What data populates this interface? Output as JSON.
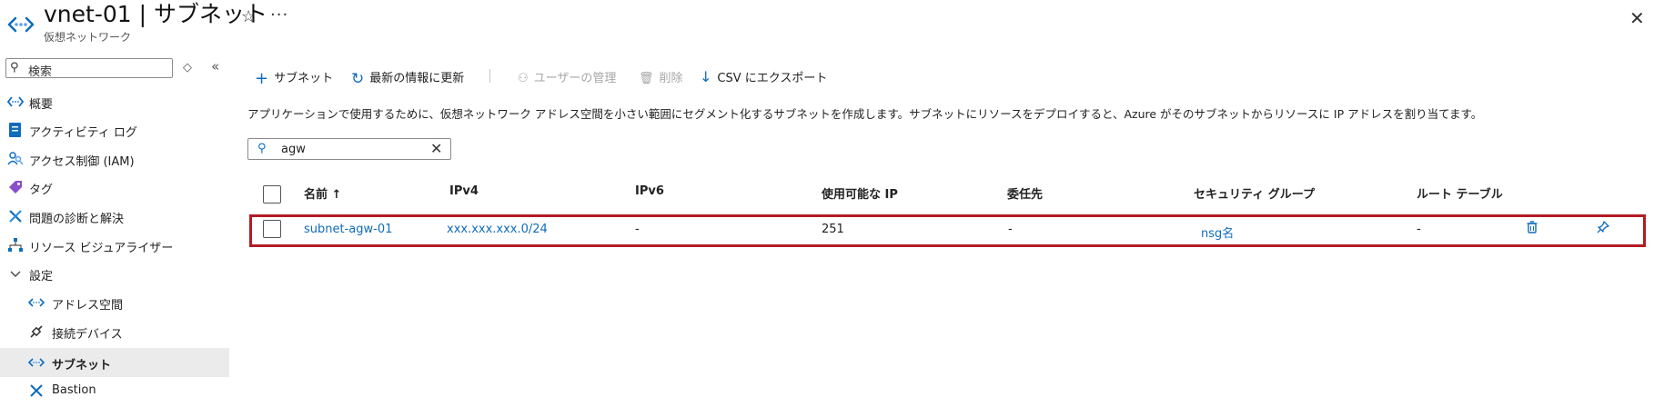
{
  "header": {
    "title": "vnet-01 | サブネット",
    "subtitle": "仮想ネットワーク",
    "star": "☆",
    "more": "···",
    "close": "✕"
  },
  "sidebar": {
    "search_placeholder": "検索",
    "collapse_glyph": "«",
    "sort_glyph": "◇",
    "items": [
      {
        "label": "概要",
        "icon": "vnet-icon"
      },
      {
        "label": "アクティビティ ログ",
        "icon": "activity-log-icon"
      },
      {
        "label": "アクセス制御 (IAM)",
        "icon": "iam-icon"
      },
      {
        "label": "タグ",
        "icon": "tag-icon"
      },
      {
        "label": "問題の診断と解決",
        "icon": "wrench-icon"
      },
      {
        "label": "リソース ビジュアライザー",
        "icon": "visualizer-icon"
      },
      {
        "label": "設定",
        "icon": "chevron-down-icon"
      },
      {
        "label": "アドレス空間",
        "icon": "address-space-icon"
      },
      {
        "label": "接続デバイス",
        "icon": "plug-icon"
      },
      {
        "label": "サブネット",
        "icon": "subnet-icon"
      },
      {
        "label": "Bastion",
        "icon": "bastion-icon"
      }
    ]
  },
  "toolbar": {
    "add_subnet": "サブネット",
    "refresh": "最新の情報に更新",
    "manage_users": "ユーザーの管理",
    "delete": "削除",
    "export_csv": "CSV にエクスポート"
  },
  "description": "アプリケーションで使用するために、仮想ネットワーク アドレス空間を小さい範囲にセグメント化するサブネットを作成します。サブネットにリソースをデプロイすると、Azure がそのサブネットからリソースに IP アドレスを割り当てます。",
  "filter": {
    "value": "agw"
  },
  "table": {
    "columns": [
      "名前 ↑",
      "IPv4",
      "IPv6",
      "使用可能な IP",
      "委任先",
      "セキュリティ グループ",
      "ルート テーブル"
    ],
    "rows": [
      {
        "name": "subnet-agw-01",
        "ipv4": "xxx.xxx.xxx.0/24",
        "ipv6": "-",
        "available_ips": "251",
        "delegated_to": "-",
        "security_group": "nsg名",
        "route_table": "-"
      }
    ]
  },
  "colors": {
    "accent": "#0f6cbd",
    "highlight_border": "#b21b24",
    "selected_bg": "#ebebeb"
  }
}
